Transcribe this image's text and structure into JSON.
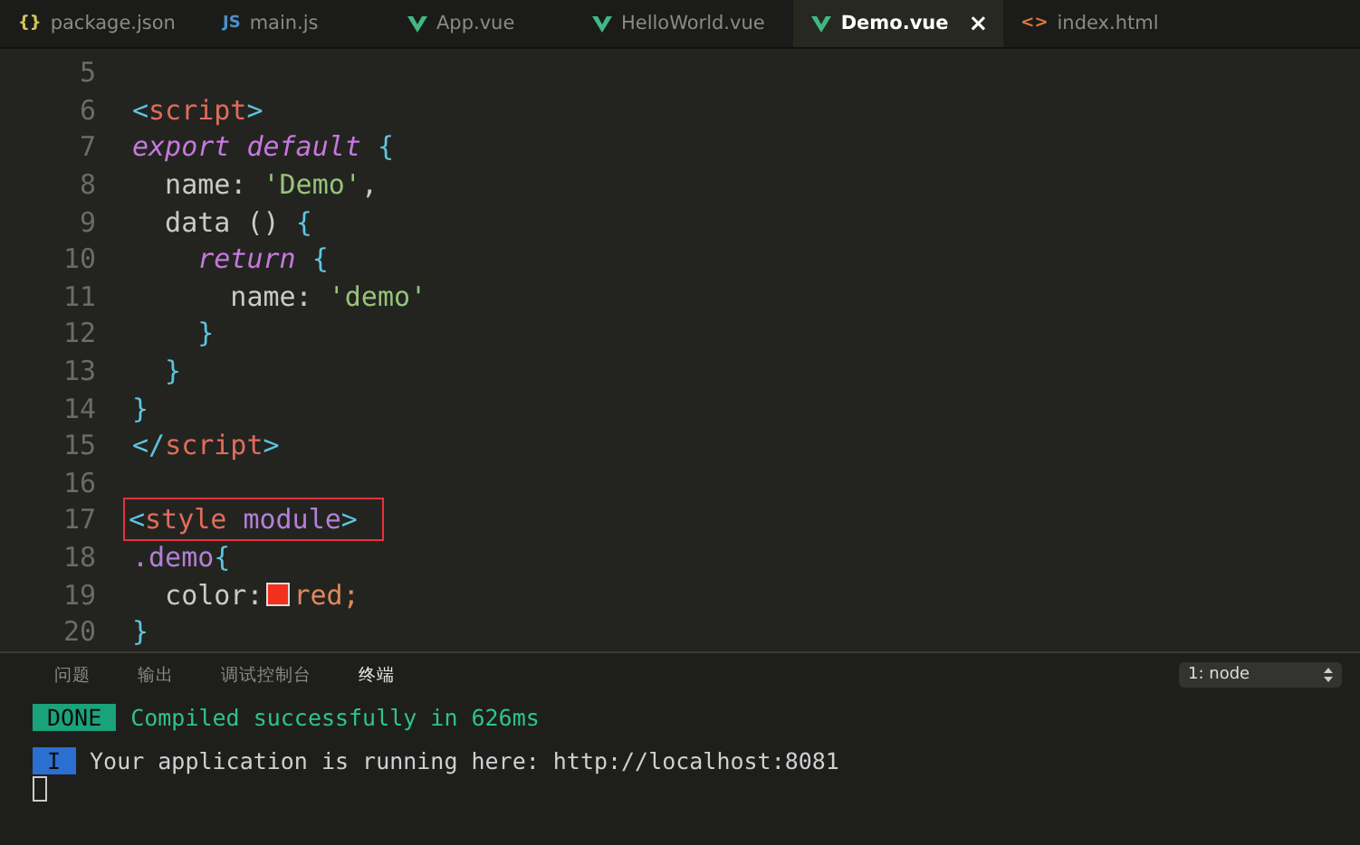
{
  "tabs": [
    {
      "label": "package.json",
      "kind": "glyph",
      "glyph": "{}",
      "selected": false
    },
    {
      "label": "main.js",
      "kind": "glyph",
      "glyph": "JS",
      "selected": false
    },
    {
      "label": "App.vue",
      "kind": "vue",
      "selected": false
    },
    {
      "label": "HelloWorld.vue",
      "kind": "vue",
      "selected": false
    },
    {
      "label": "Demo.vue",
      "kind": "vue",
      "selected": true,
      "close": "×"
    },
    {
      "label": "index.html",
      "kind": "glyph",
      "glyph": "<>",
      "selected": false
    }
  ],
  "editor": {
    "lines": [
      {
        "number": "5"
      },
      {
        "number": "6",
        "tokens": [
          {
            "text": "<",
            "kind": "punct"
          },
          {
            "text": "script",
            "kind": "tag"
          },
          {
            "text": ">",
            "kind": "punct"
          }
        ]
      },
      {
        "number": "7",
        "tokens": [
          {
            "text": "export default",
            "kind": "keyword"
          },
          {
            "text": " {",
            "kind": "punct"
          }
        ]
      },
      {
        "number": "8",
        "tokens": [
          {
            "text": "  name: ",
            "kind": "plain"
          },
          {
            "text": "'Demo'",
            "kind": "string"
          },
          {
            "text": ",",
            "kind": "plain"
          }
        ]
      },
      {
        "number": "9",
        "tokens": [
          {
            "text": "  data () ",
            "kind": "plain"
          },
          {
            "text": "{",
            "kind": "punct"
          }
        ]
      },
      {
        "number": "10",
        "tokens": [
          {
            "text": "    return",
            "kind": "keyword"
          },
          {
            "text": " {",
            "kind": "punct"
          }
        ]
      },
      {
        "number": "11",
        "tokens": [
          {
            "text": "      name: ",
            "kind": "plain"
          },
          {
            "text": "'demo'",
            "kind": "string"
          }
        ]
      },
      {
        "number": "12",
        "tokens": [
          {
            "text": "    }",
            "kind": "punct"
          }
        ]
      },
      {
        "number": "13",
        "tokens": [
          {
            "text": "  }",
            "kind": "punct"
          }
        ]
      },
      {
        "number": "14",
        "tokens": [
          {
            "text": "}",
            "kind": "punct"
          }
        ]
      },
      {
        "number": "15",
        "tokens": [
          {
            "text": "</",
            "kind": "punct"
          },
          {
            "text": "script",
            "kind": "tag"
          },
          {
            "text": ">",
            "kind": "punct"
          }
        ]
      },
      {
        "number": "16"
      },
      {
        "number": "17",
        "boxed": true,
        "tokens": [
          {
            "text": "<",
            "kind": "punct"
          },
          {
            "text": "style ",
            "kind": "tag"
          },
          {
            "text": "module",
            "kind": "attr"
          },
          {
            "text": ">",
            "kind": "punct"
          }
        ]
      },
      {
        "number": "18",
        "tokens": [
          {
            "text": ".demo",
            "kind": "attr"
          },
          {
            "text": "{",
            "kind": "punct"
          }
        ]
      },
      {
        "number": "19",
        "tokens": [
          {
            "text": "  color:",
            "kind": "plain"
          },
          {
            "kind": "swatch",
            "color": "#f2301c"
          },
          {
            "text": "red;",
            "kind": "value"
          }
        ]
      },
      {
        "number": "20",
        "tokens": [
          {
            "text": "}",
            "kind": "punct"
          }
        ]
      }
    ]
  },
  "panel": {
    "tabs": [
      {
        "label": "问题",
        "selected": false
      },
      {
        "label": "输出",
        "selected": false
      },
      {
        "label": "调试控制台",
        "selected": false
      },
      {
        "label": "终端",
        "selected": true
      }
    ],
    "terminal_select": "1: node",
    "terminal": [
      {
        "badge": "DONE",
        "kind": "done",
        "text": "Compiled successfully in 626ms"
      },
      {
        "badge": "I",
        "kind": "info",
        "text": "Your application is running here: http://localhost:8081"
      }
    ],
    "cursor": true
  }
}
